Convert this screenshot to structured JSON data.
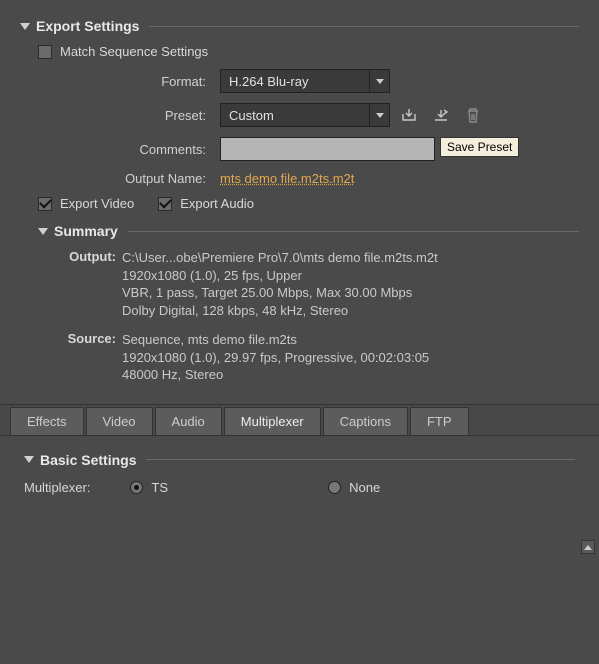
{
  "exportSettings": {
    "title": "Export Settings",
    "matchSequence": {
      "label": "Match Sequence Settings",
      "checked": false
    },
    "format": {
      "label": "Format:",
      "value": "H.264 Blu-ray"
    },
    "preset": {
      "label": "Preset:",
      "value": "Custom"
    },
    "presetButtons": {
      "saveTooltip": "Save Preset"
    },
    "comments": {
      "label": "Comments:",
      "value": ""
    },
    "outputName": {
      "label": "Output Name:",
      "value": "mts demo file.m2ts.m2t"
    },
    "exportVideo": {
      "label": "Export Video",
      "checked": true
    },
    "exportAudio": {
      "label": "Export Audio",
      "checked": true
    }
  },
  "summary": {
    "title": "Summary",
    "output": {
      "label": "Output:",
      "line1": "C:\\User...obe\\Premiere Pro\\7.0\\mts demo file.m2ts.m2t",
      "line2": "1920x1080 (1.0), 25 fps, Upper",
      "line3": "VBR, 1 pass, Target 25.00 Mbps, Max 30.00 Mbps",
      "line4": "Dolby Digital, 128 kbps, 48 kHz, Stereo"
    },
    "source": {
      "label": "Source:",
      "line1": "Sequence, mts demo file.m2ts",
      "line2": "1920x1080 (1.0), 29.97 fps, Progressive, 00:02:03:05",
      "line3": "48000 Hz, Stereo"
    }
  },
  "tabs": {
    "effects": "Effects",
    "video": "Video",
    "audio": "Audio",
    "multiplexer": "Multiplexer",
    "captions": "Captions",
    "ftp": "FTP",
    "active": "multiplexer"
  },
  "basicSettings": {
    "title": "Basic Settings",
    "multiplexer": {
      "label": "Multiplexer:",
      "options": {
        "ts": "TS",
        "none": "None"
      },
      "selected": "ts"
    }
  }
}
